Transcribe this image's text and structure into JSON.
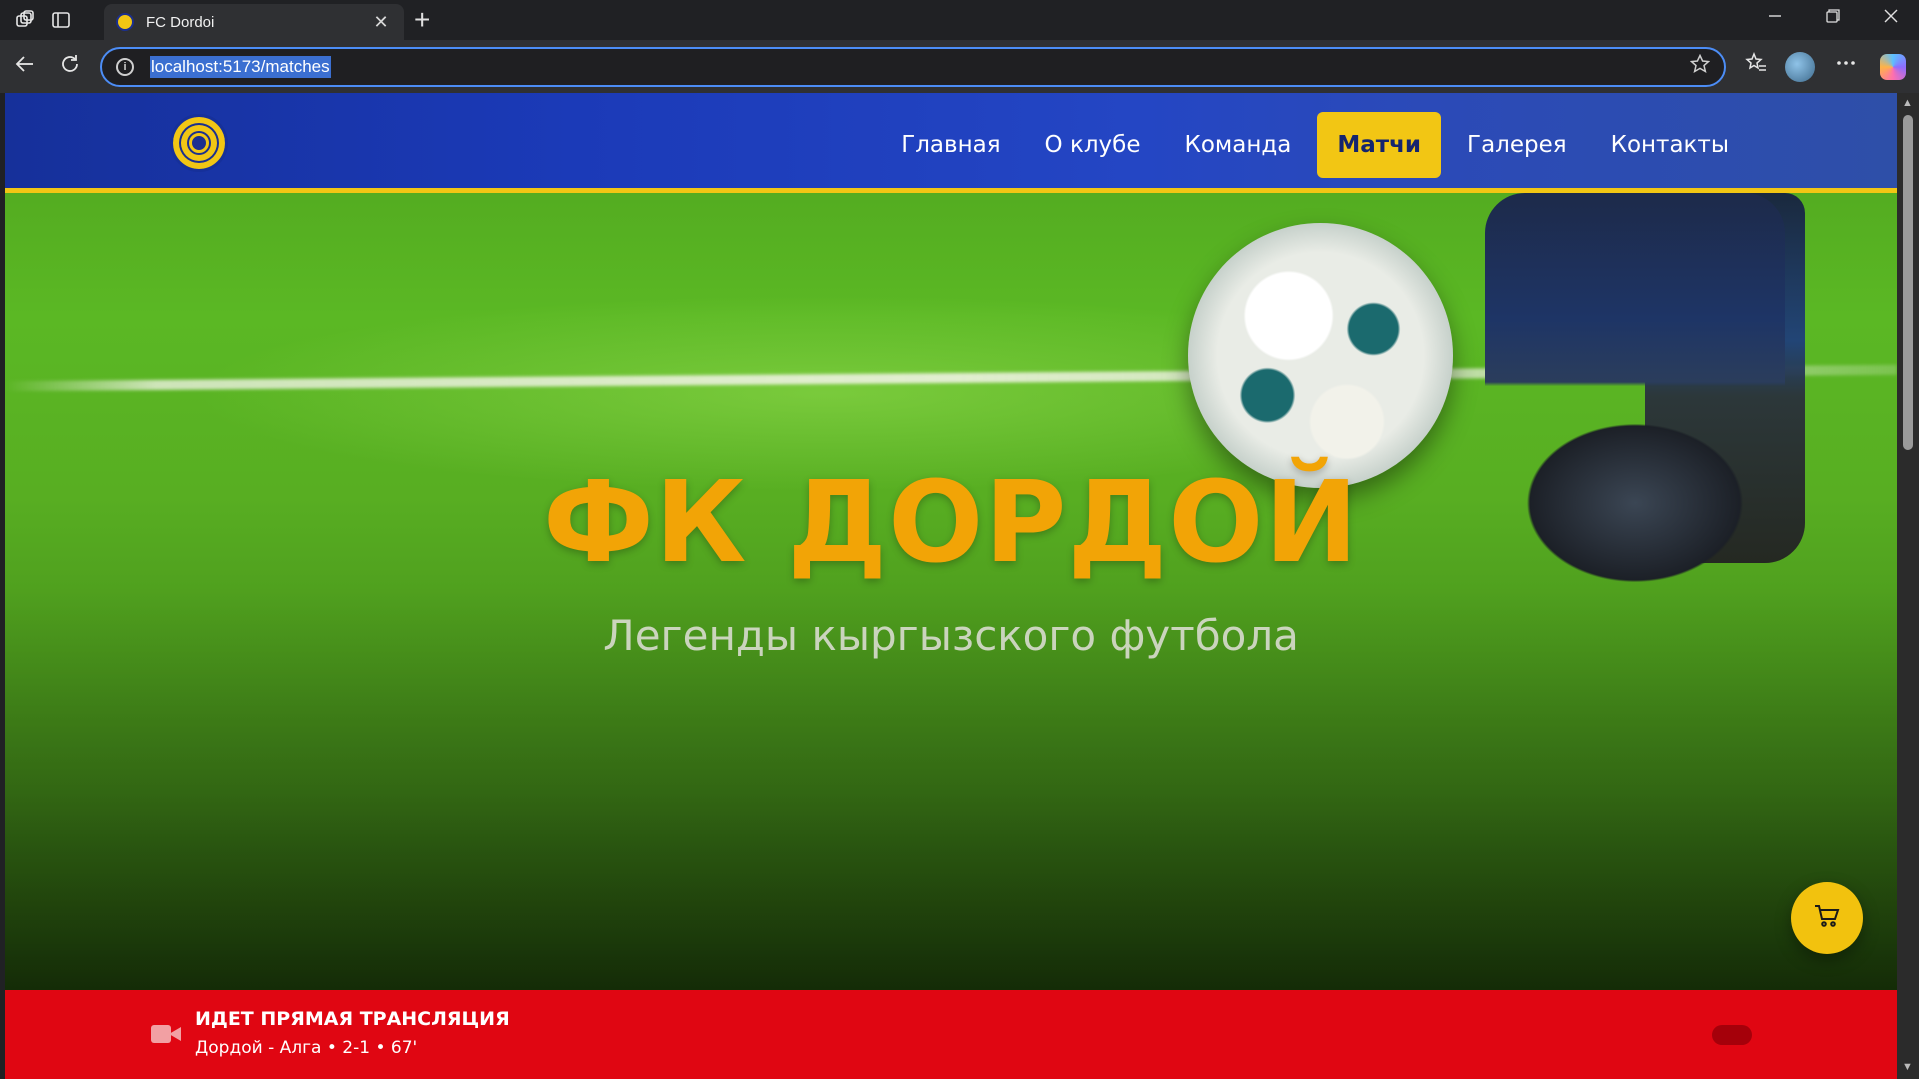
{
  "browser": {
    "tab_title": "FC Dordoi",
    "tab_close": "✕",
    "new_tab": "+",
    "url": "localhost:5173/matches",
    "info_glyph": "i"
  },
  "site": {
    "nav": [
      "Главная",
      "О клубе",
      "Команда",
      "Матчи",
      "Галерея",
      "Контакты"
    ],
    "active_nav": "Матчи",
    "hero": {
      "title": "ФК ДОРДОЙ",
      "subtitle": "Легенды кыргызского футбола"
    },
    "live": {
      "title": "ИДЕТ ПРЯМАЯ ТРАНСЛЯЦИЯ",
      "match": "Дордой - Алга • 2-1 • 67'"
    }
  },
  "colors": {
    "brand_blue": "#1b3ab8",
    "brand_yellow": "#f2c614",
    "live_red": "#e00612",
    "hero_title": "#f2a406"
  },
  "icons": {
    "workspaces": "workspaces-icon",
    "tab_actions": "tab-actions-icon",
    "back": "back-arrow-icon",
    "reload": "reload-icon",
    "info": "info-icon",
    "favorite": "star-icon",
    "favorites_bar": "favorites-icon",
    "menu": "more-icon",
    "copilot": "copilot-icon",
    "live": "video-camera-icon",
    "cart": "cart-icon"
  }
}
